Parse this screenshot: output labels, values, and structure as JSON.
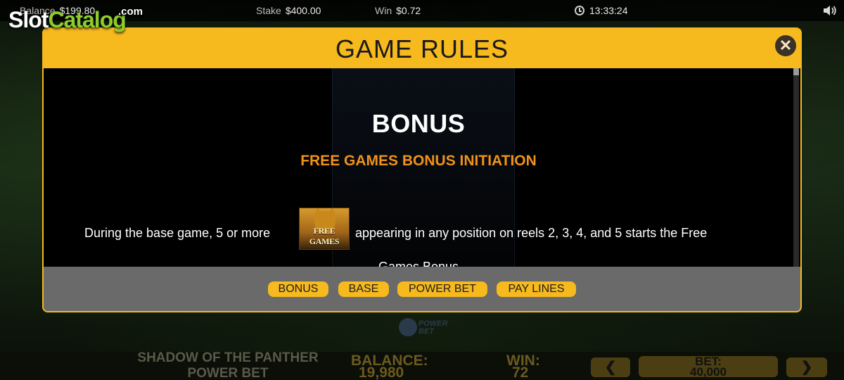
{
  "topbar": {
    "balance_label": "Balance",
    "balance_value": "$199.80",
    "stake_label": "Stake",
    "stake_value": "$400.00",
    "win_label": "Win",
    "win_value": "$0.72",
    "clock": "13:33:24",
    "clock_icon": "clock-icon",
    "sound_icon": "speaker-icon"
  },
  "watermark": {
    "part1": "Slot",
    "part2": "Catalog",
    "suffix": ".com"
  },
  "modal": {
    "title": "GAME RULES",
    "close_icon": "close-icon",
    "close_glyph": "✕",
    "section_title": "BONUS",
    "subsection_title": "FREE GAMES BONUS INITIATION",
    "rule_before": "During the base game, 5 or more",
    "symbol_label": "FREE GAMES",
    "rule_after": "appearing in any position on reels 2, 3, 4, and 5 starts the Free",
    "rule_continued": "Games Bonus",
    "tabs": [
      {
        "label": "BONUS"
      },
      {
        "label": "BASE"
      },
      {
        "label": "POWER BET"
      },
      {
        "label": "PAY LINES"
      }
    ],
    "accent_color": "#f6b91e",
    "subtitle_color": "#f0921a"
  },
  "game": {
    "name_line1": "SHADOW OF THE PANTHER",
    "name_line2": "POWER BET",
    "balance_label": "BALANCE:",
    "balance_value": "19,980",
    "win_label": "WIN:",
    "win_value": "72",
    "bet_label": "BET:",
    "bet_value": "40,000",
    "prev_glyph": "❮",
    "next_glyph": "❯",
    "power_logo_text": "POWER BET"
  }
}
